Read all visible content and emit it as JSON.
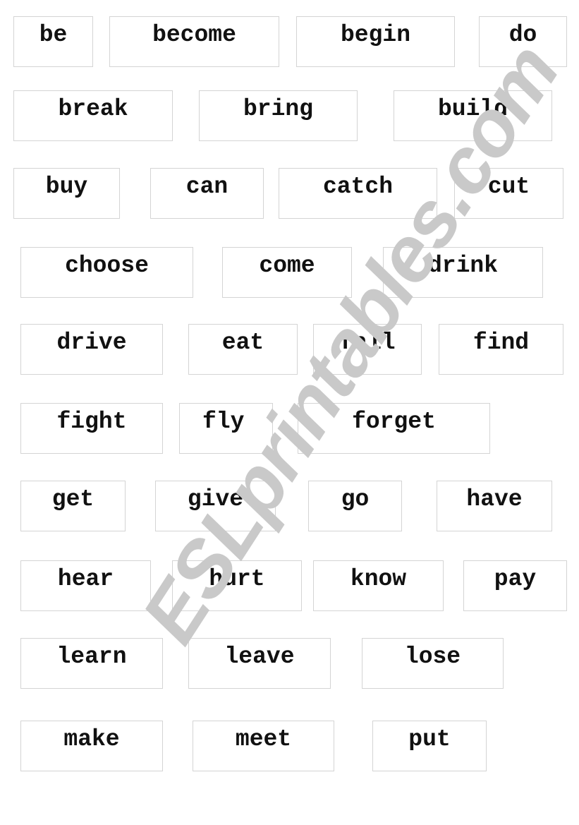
{
  "worksheet": {
    "title": "",
    "rows": [
      [
        "be",
        "become",
        "begin",
        "do"
      ],
      [
        "break",
        "bring",
        "build"
      ],
      [
        "buy",
        "can",
        "catch",
        "cut"
      ],
      [
        "choose",
        "come",
        "drink"
      ],
      [
        "drive",
        "eat",
        "fall",
        "find"
      ],
      [
        "fight",
        "fly",
        "forget"
      ],
      [
        "get",
        "give",
        "go",
        "have"
      ],
      [
        "hear",
        "hurt",
        "know",
        "pay"
      ],
      [
        "learn",
        "leave",
        "lose"
      ],
      [
        "make",
        "meet",
        "put"
      ]
    ]
  },
  "watermark": {
    "text": "ESLprintables.com",
    "color": "#c9c9c9"
  },
  "colors": {
    "text": "#111111",
    "card_border": "#d4d4d4",
    "background": "#ffffff"
  }
}
